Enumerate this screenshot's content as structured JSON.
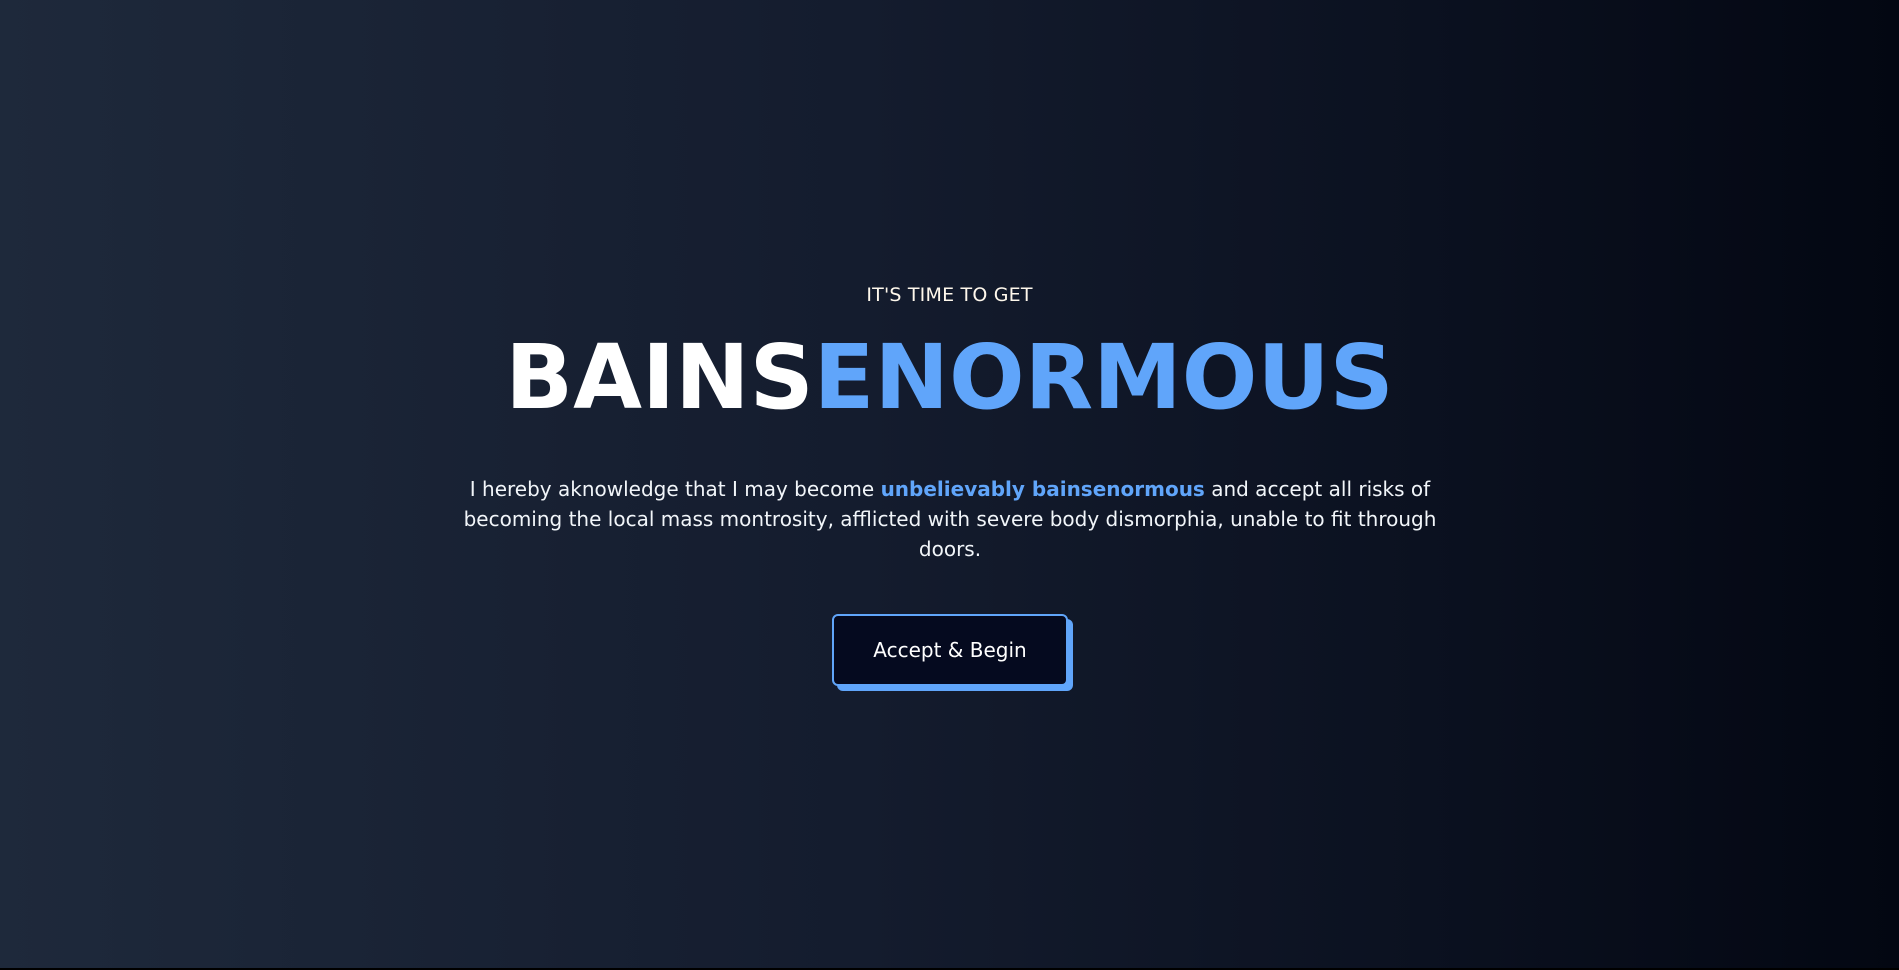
{
  "hero": {
    "eyebrow": "IT'S TIME TO GET",
    "title_part_a": "BAINS",
    "title_part_b": "ENORMOUS",
    "body_before": "I hereby aknowledge that I may become ",
    "body_highlight": "unbelievably bainsenormous",
    "body_after": " and accept all risks of becoming the local mass montrosity, afflicted with severe body dismorphia, unable to fit through doors.",
    "button_label": "Accept & Begin"
  },
  "colors": {
    "accent": "#60a5fa",
    "background_start": "#1e293b",
    "background_end": "#030712",
    "button_background": "#050a1f",
    "text": "#ffffff"
  }
}
